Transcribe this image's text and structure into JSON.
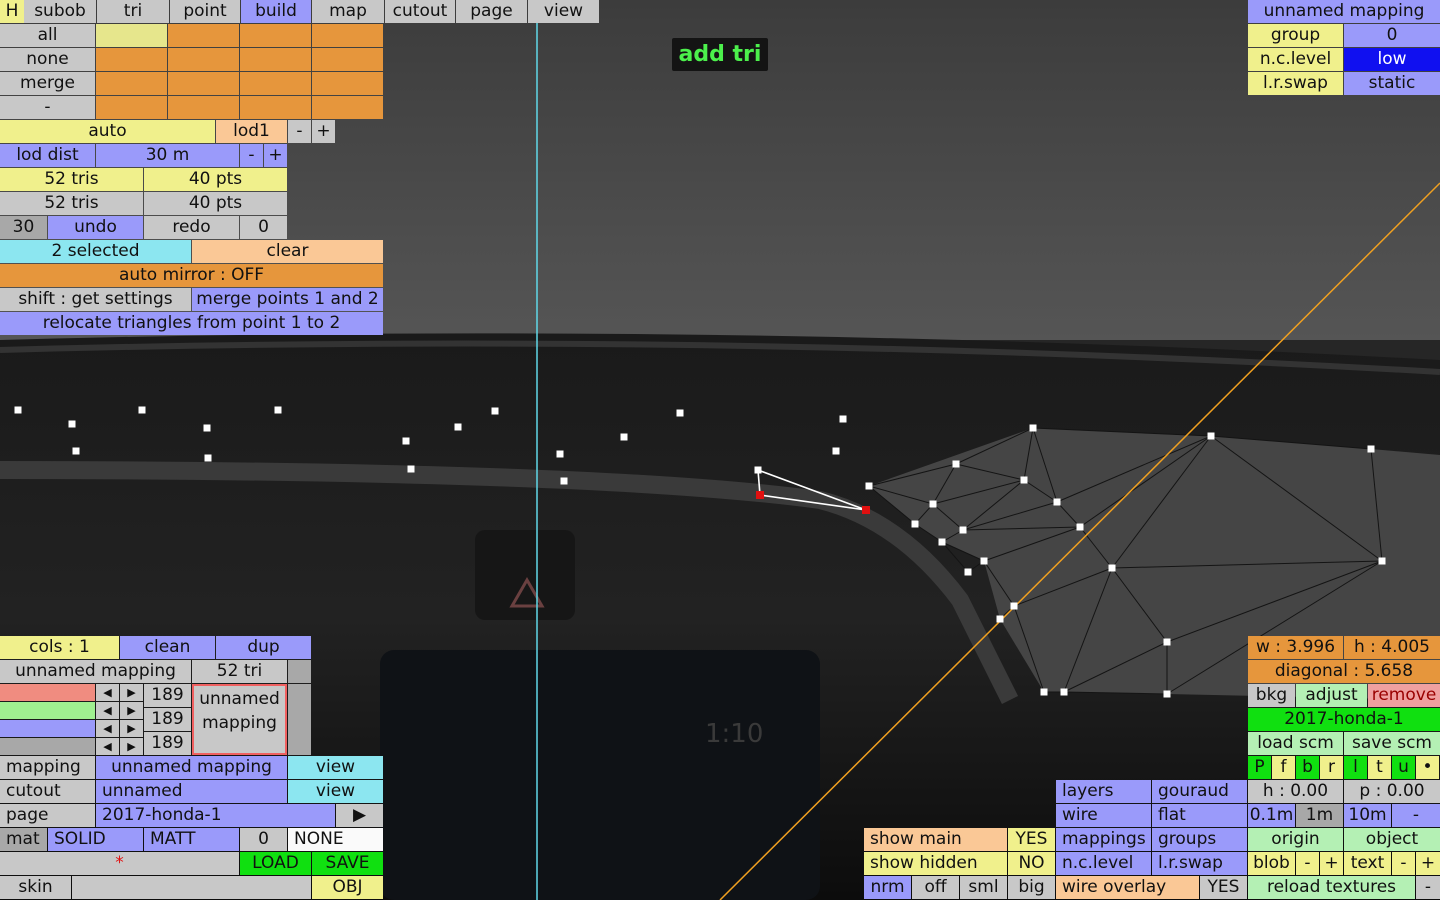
{
  "overlay": {
    "add_tri": "add tri"
  },
  "tabs": [
    "H",
    "subob",
    "tri",
    "point",
    "build",
    "map",
    "cutout",
    "page",
    "view"
  ],
  "select_panel": {
    "all": "all",
    "none": "none",
    "merge": "merge",
    "minus": "-"
  },
  "lod": {
    "auto": "auto",
    "lod1": "lod1",
    "minus": "-",
    "plus": "+",
    "dist_label": "lod dist",
    "dist_value": "30 m"
  },
  "stats": [
    {
      "tris": "52 tris",
      "pts": "40 pts"
    },
    {
      "tris": "52 tris",
      "pts": "40 pts"
    }
  ],
  "history": {
    "count": "30",
    "undo": "undo",
    "redo": "redo",
    "redo_count": "0"
  },
  "selection": {
    "selected": "2 selected",
    "clear": "clear",
    "auto_mirror": "auto mirror : OFF",
    "shift": "shift : get settings",
    "merge_points": "merge points 1 and 2",
    "relocate": "relocate triangles from point 1 to 2"
  },
  "mapping_top": {
    "title": "unnamed mapping",
    "group_label": "group",
    "group_value": "0",
    "ncl_label": "n.c.level",
    "ncl_value": "low",
    "lr_label": "l.r.swap",
    "lr_value": "static"
  },
  "cols_panel": {
    "cols": "cols : 1",
    "clean": "clean",
    "dup": "dup",
    "name": "unnamed mapping",
    "tri_count": "52 tri",
    "rgb_values": [
      "189",
      "189",
      "189"
    ],
    "preview_label": "unnamed mapping"
  },
  "colors": {
    "red_swatch": "#f08c80",
    "green_swatch": "#a0f090",
    "blue_swatch": "#9a9afa",
    "grey_swatch": "#a8a8a8",
    "wire": "#ffffff",
    "orange_line": "#f0a020",
    "cyan_line": "#60d8e8"
  },
  "bottom_left": {
    "mapping_label": "mapping",
    "mapping_value": "unnamed mapping",
    "view": "view",
    "cutout_label": "cutout",
    "cutout_value": "unnamed",
    "page_label": "page",
    "page_value": "2017-honda-1",
    "arrow": "▶",
    "mat": "mat",
    "solid": "SOLID",
    "matt": "MATT",
    "mat_num": "0",
    "none": "NONE",
    "asterisk": "*",
    "load": "LOAD",
    "save": "SAVE",
    "skin": "skin",
    "obj": "OBJ"
  },
  "dims": {
    "w": "w : 3.996",
    "h": "h : 4.005",
    "diagonal": "diagonal : 5.658"
  },
  "bkg_row": {
    "bkg": "bkg",
    "adjust": "adjust",
    "remove": "remove"
  },
  "scm": {
    "name": "2017-honda-1",
    "load": "load scm",
    "save": "save scm"
  },
  "pfb": [
    "P",
    "f",
    "b",
    "r",
    "l",
    "t",
    "u",
    "•"
  ],
  "hp": {
    "h": "h : 0.00",
    "p": "p : 0.00"
  },
  "steps": [
    "0.1m",
    "1m",
    "10m",
    "-"
  ],
  "origin": {
    "origin": "origin",
    "object": "object"
  },
  "blob_row": {
    "blob": "blob",
    "minus": "-",
    "plus": "+",
    "text": "text",
    "minus2": "-",
    "plus2": "+"
  },
  "reload": {
    "label": "reload textures",
    "minus": "-"
  },
  "render_panel": {
    "layers": "layers",
    "gouraud": "gouraud",
    "wire": "wire",
    "flat": "flat",
    "mappings": "mappings",
    "groups": "groups",
    "ncl": "n.c.level",
    "lr": "l.r.swap",
    "wire_overlay": "wire overlay",
    "wire_overlay_value": "YES"
  },
  "show_panel": {
    "show_main": "show main",
    "show_main_value": "YES",
    "show_hidden": "show hidden",
    "show_hidden_value": "NO",
    "nrm": "nrm",
    "off": "off",
    "sml": "sml",
    "big": "big"
  },
  "scene_text": {
    "clock": "1:10"
  }
}
